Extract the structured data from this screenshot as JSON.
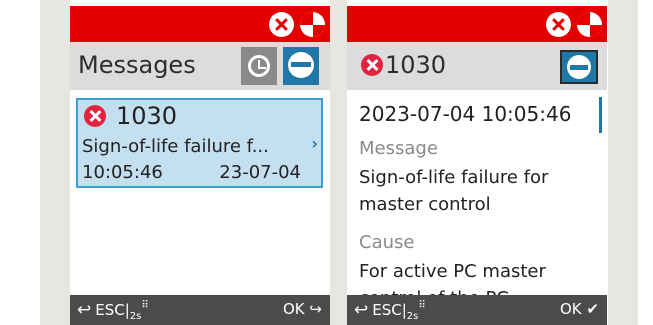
{
  "left_screen": {
    "title": "Messages",
    "card": {
      "code": "1030",
      "text": "Sign-of-life failure f...",
      "chevron": "›",
      "time": "10:05:46",
      "date": "23-07-04"
    },
    "footer": {
      "back_label": "ESC",
      "hold_label": "2s",
      "ok_label": "OK"
    }
  },
  "right_screen": {
    "code": "1030",
    "datetime": "2023-07-04  10:05:46",
    "message_label": "Message",
    "message_lines": [
      "Sign-of-life failure for",
      "master control"
    ],
    "cause_label": "Cause",
    "cause_lines": [
      "For active PC master",
      "control of the PC"
    ],
    "footer": {
      "back_label": "ESC",
      "hold_label": "2s",
      "ok_label": "OK"
    }
  },
  "colors": {
    "status_bar": "#e50000",
    "accent": "#1f78a8",
    "card_bg": "#c4dff0",
    "error": "#e2233f",
    "footer": "#4b4b4b"
  },
  "icons": [
    "error-icon",
    "maintenance-icon",
    "history-icon",
    "filter-icon",
    "back-arrow-icon",
    "keypad-icon",
    "enter-arrow-icon",
    "checkmark-icon"
  ]
}
